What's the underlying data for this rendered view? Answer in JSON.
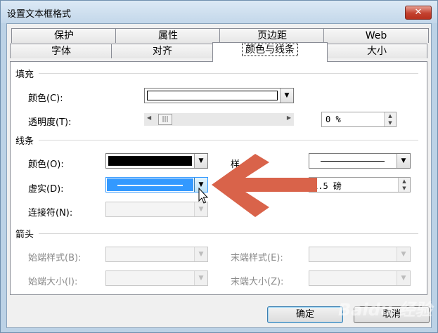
{
  "window": {
    "title": "设置文本框格式",
    "close_label": "✕"
  },
  "tabs_back": [
    "保护",
    "属性",
    "页边距",
    "Web"
  ],
  "tabs_front": [
    "字体",
    "对齐",
    "颜色与线条",
    "大小"
  ],
  "active_tab": "颜色与线条",
  "fill": {
    "group_label": "填充",
    "color_label": "颜色(C):",
    "color_value": "#ffffff",
    "transparency_label": "透明度(T):",
    "transparency_value": "0 %",
    "transparency_fraction": 0
  },
  "line": {
    "group_label": "线条",
    "color_label": "颜色(O):",
    "color_value": "#000000",
    "style_label": "样式(S):",
    "style_label_visible": "样",
    "dash_label": "虚实(D):",
    "weight_value": "1.5 磅",
    "connector_label": "连接符(N):"
  },
  "arrows": {
    "group_label": "箭头",
    "begin_style_label": "始端样式(B):",
    "end_style_label": "末端样式(E):",
    "begin_size_label": "始端大小(I):",
    "end_size_label": "末端大小(Z):"
  },
  "buttons": {
    "ok": "确定",
    "cancel": "取消"
  },
  "annotation": {
    "arrow_color": "#d9634a"
  },
  "watermark": "Baidu 经验"
}
